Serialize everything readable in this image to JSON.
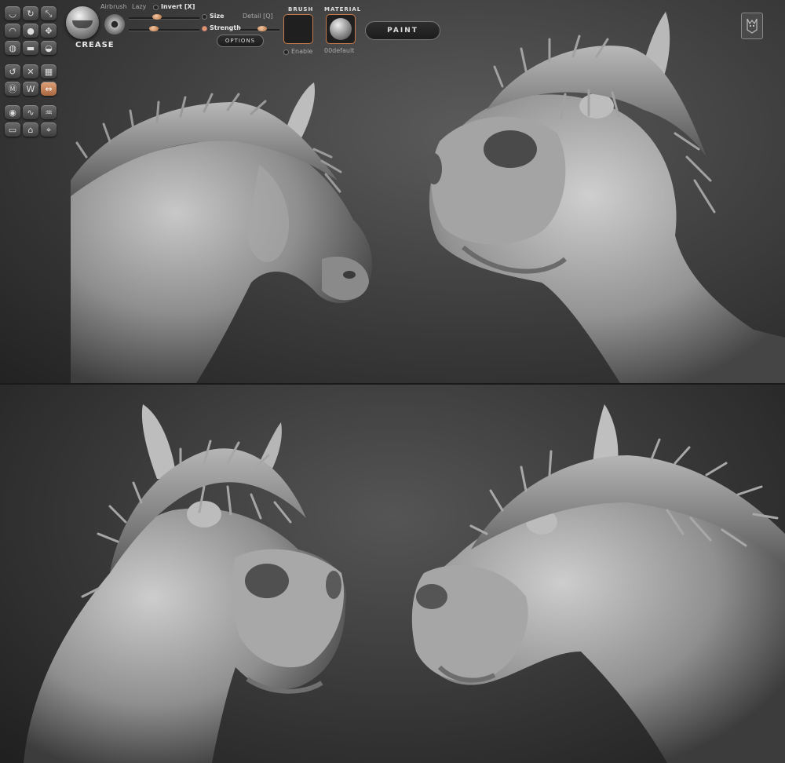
{
  "toolbar": {
    "tool_icons": [
      "sculpt-standard-icon",
      "rotate-icon",
      "scale-icon",
      "clay-icon",
      "inflate-icon",
      "move-icon",
      "smooth-icon",
      "layer-icon",
      "pinch-icon",
      "draw-icon",
      "mask-icon",
      "grid-icon",
      "transform-icon",
      "symmetry-icon",
      "active-mirror-icon",
      "polyframe-icon",
      "snake-icon",
      "clay-tubes-icon",
      "flatten-icon",
      "polish-icon",
      "hpolish-icon"
    ],
    "brush_name": "CREASE",
    "airbrush_label": "Airbrush",
    "lazy_label": "Lazy",
    "invert_label": "Invert [X]",
    "size_label": "Size",
    "detail_label": "Detail [Q]",
    "strength_label": "Strength",
    "options_label": "OPTIONS",
    "brush_slot_title": "BRUSH",
    "material_slot_title": "MATERIAL",
    "enable_label": "Enable",
    "material_name": "00default",
    "paint_label": "PAINT",
    "size_value": 0.35,
    "strength_value": 0.45,
    "detail_value": 0.55,
    "lazy_value": 0.4,
    "accent_color": "#c87a4a",
    "logo_icon": "app-logo-icon"
  },
  "viewports": [
    {
      "name": "horse-head-side-view"
    },
    {
      "name": "horse-head-front-left-view"
    },
    {
      "name": "horse-head-front-right-view"
    },
    {
      "name": "horse-head-three-quarter-view"
    }
  ]
}
